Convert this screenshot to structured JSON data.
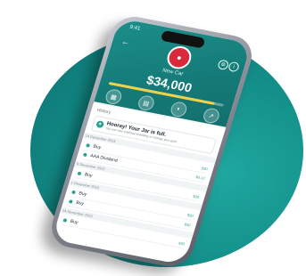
{
  "status": {
    "time": "9:41"
  },
  "header": {
    "jar_title": "New Car",
    "amount": "$34,000",
    "progress_fraction": 0.92
  },
  "actions": [
    {
      "label": "Invest",
      "icon": "invest-icon"
    },
    {
      "label": "Withdraw",
      "icon": "withdraw-icon"
    },
    {
      "label": "Portfolio",
      "icon": "portfolio-icon"
    },
    {
      "label": "Performance",
      "icon": "performance-icon"
    }
  ],
  "list": {
    "header": "History",
    "tip_title": "Hooray! Your Jar is full.",
    "tip_sub": "You can now continue investing or change your goal",
    "groups": [
      {
        "date": "14 December 2023",
        "rows": [
          {
            "label": "Buy",
            "amount": "$30"
          },
          {
            "label": "AAA Dividend",
            "amount": "$0.12"
          }
        ]
      },
      {
        "date": "8 December 2023",
        "rows": [
          {
            "label": "Buy",
            "amount": "$30"
          }
        ]
      },
      {
        "date": "1 December 2023",
        "rows": [
          {
            "label": "Buy",
            "amount": "$30"
          },
          {
            "label": "Buy",
            "amount": "$30"
          }
        ]
      },
      {
        "date": "24 November 2023",
        "rows": [
          {
            "label": "Buy",
            "amount": "$30"
          }
        ]
      }
    ]
  },
  "colors": {
    "brand_teal": "#1b8f8a",
    "accent_yellow": "#f0d24a",
    "avatar_red": "#d82a3a"
  }
}
